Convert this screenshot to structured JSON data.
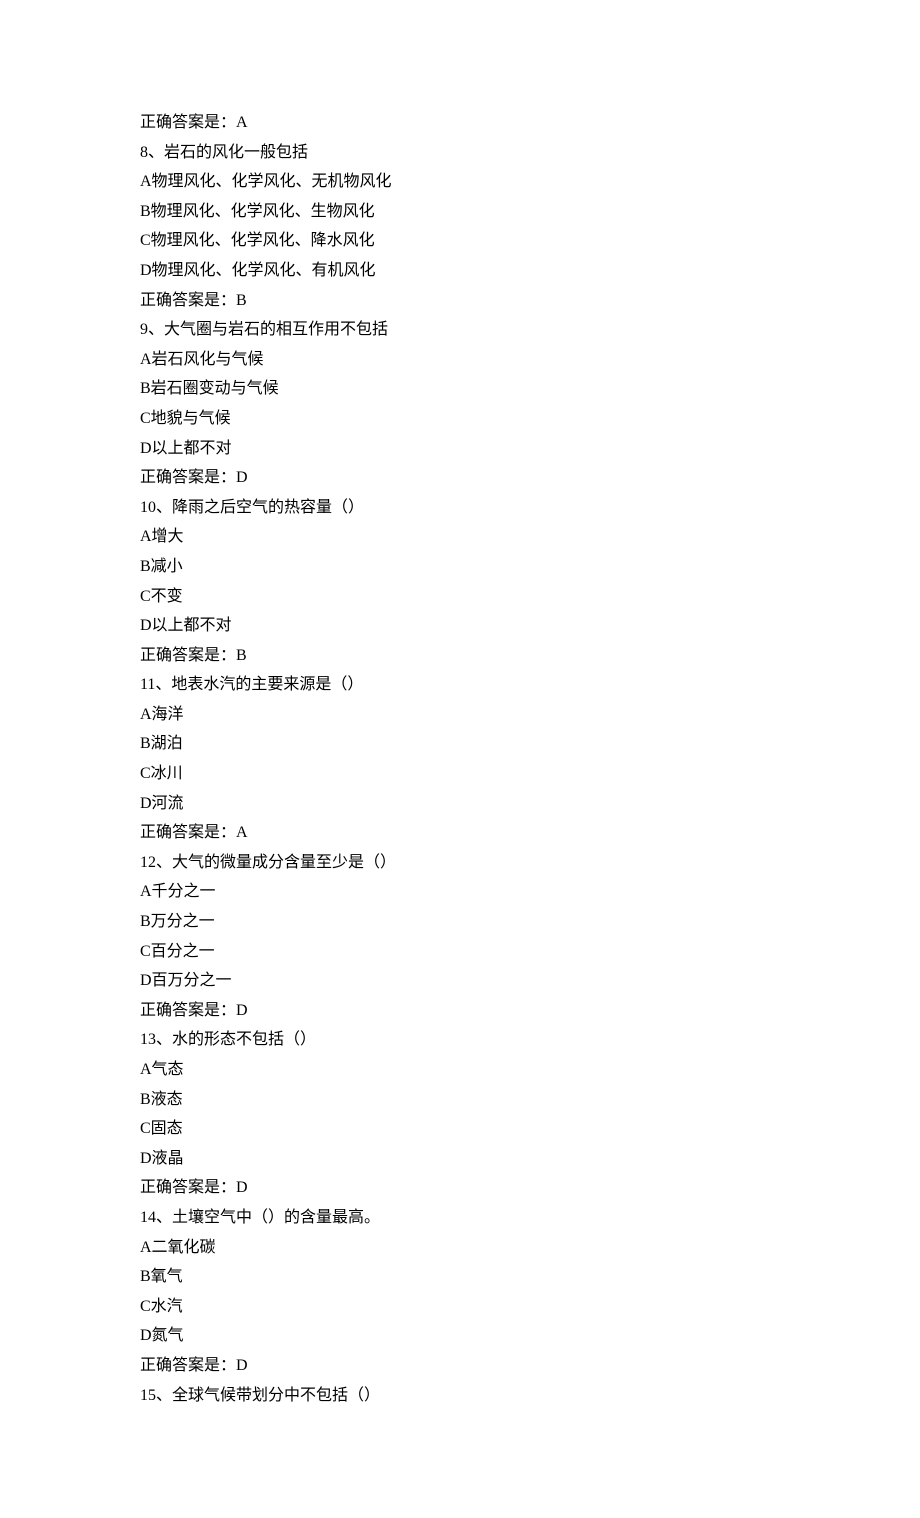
{
  "lines": [
    "正确答案是：A",
    "8、岩石的风化一般包括",
    "A物理风化、化学风化、无机物风化",
    "B物理风化、化学风化、生物风化",
    "C物理风化、化学风化、降水风化",
    "D物理风化、化学风化、有机风化",
    "正确答案是：B",
    "9、大气圈与岩石的相互作用不包括",
    "A岩石风化与气候",
    "B岩石圈变动与气候",
    "C地貌与气候",
    "D以上都不对",
    "正确答案是：D",
    "10、降雨之后空气的热容量（）",
    "A增大",
    "B减小",
    "C不变",
    "D以上都不对",
    "正确答案是：B",
    "11、地表水汽的主要来源是（）",
    "A海洋",
    "B湖泊",
    "C冰川",
    "D河流",
    "正确答案是：A",
    "12、大气的微量成分含量至少是（）",
    "A千分之一",
    "B万分之一",
    "C百分之一",
    "D百万分之一",
    "正确答案是：D",
    "13、水的形态不包括（）",
    "A气态",
    "B液态",
    "C固态",
    "D液晶",
    "正确答案是：D",
    "14、土壤空气中（）的含量最高。",
    "A二氧化碳",
    "B氧气",
    "C水汽",
    "D氮气",
    "正确答案是：D",
    "15、全球气候带划分中不包括（）"
  ]
}
